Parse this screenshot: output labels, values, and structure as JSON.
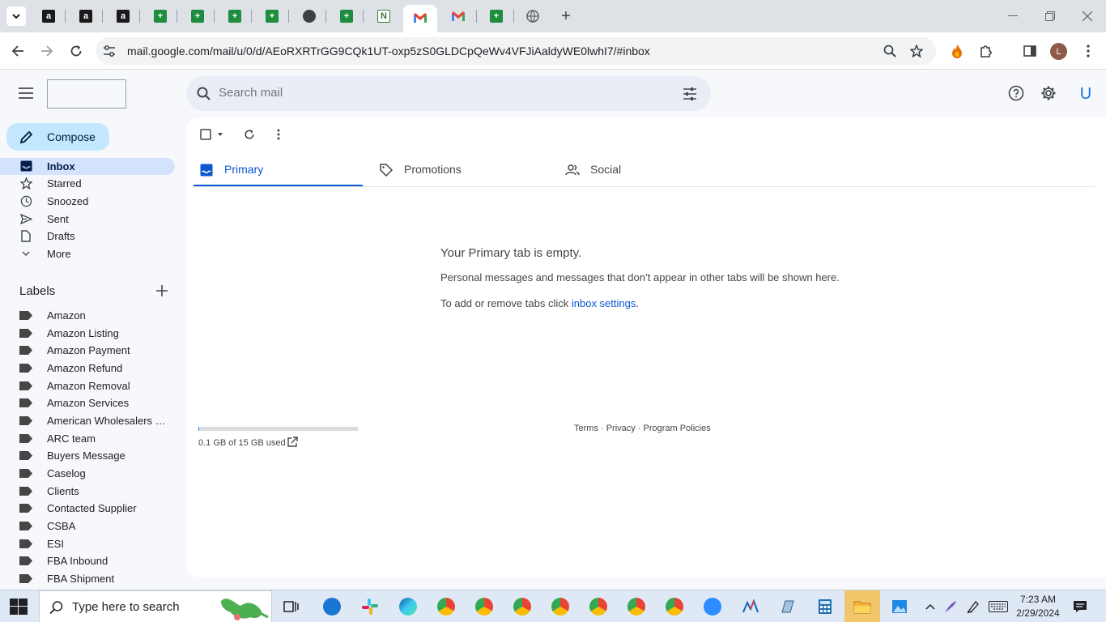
{
  "browser": {
    "url": "mail.google.com/mail/u/0/d/AEoRXRTrGG9CQk1UT-oxp5zS0GLDCpQeWv4VFJiAaldyWE0lwhI7/#inbox",
    "profile_initial": "L",
    "tabs": [
      {
        "icon": "amazon-icon",
        "glyph": "a"
      },
      {
        "icon": "amazon-icon",
        "glyph": "a"
      },
      {
        "icon": "amazon-icon",
        "glyph": "a"
      },
      {
        "icon": "sheets-icon",
        "glyph": "+"
      },
      {
        "icon": "sheets-icon",
        "glyph": "+"
      },
      {
        "icon": "sheets-icon",
        "glyph": "+"
      },
      {
        "icon": "sheets-icon",
        "glyph": "+"
      },
      {
        "icon": "globe-icon",
        "glyph": ""
      },
      {
        "icon": "sheets-icon",
        "glyph": "+"
      },
      {
        "icon": "green-logo-icon",
        "glyph": "N"
      },
      {
        "icon": "gmail-icon",
        "glyph": "M"
      },
      {
        "icon": "gmail-icon",
        "glyph": "M"
      },
      {
        "icon": "sheets-icon",
        "glyph": "+"
      },
      {
        "icon": "globe-icon",
        "glyph": ""
      }
    ]
  },
  "gmail": {
    "search_placeholder": "Search mail",
    "account_initial": "U",
    "compose_label": "Compose",
    "nav": [
      {
        "label": "Inbox",
        "icon": "inbox-icon",
        "active": true
      },
      {
        "label": "Starred",
        "icon": "star-icon"
      },
      {
        "label": "Snoozed",
        "icon": "clock-icon"
      },
      {
        "label": "Sent",
        "icon": "send-icon"
      },
      {
        "label": "Drafts",
        "icon": "draft-icon"
      },
      {
        "label": "More",
        "icon": "chevron-down-icon"
      }
    ],
    "labels_title": "Labels",
    "labels": [
      "Amazon",
      "Amazon Listing",
      "Amazon Payment",
      "Amazon Refund",
      "Amazon Removal",
      "Amazon Services",
      "American Wholesalers L...",
      "ARC team",
      "Buyers Message",
      "Caselog",
      "Clients",
      "Contacted Supplier",
      "CSBA",
      "ESI",
      "FBA Inbound",
      "FBA Shipment"
    ],
    "tabs": {
      "primary": "Primary",
      "promotions": "Promotions",
      "social": "Social"
    },
    "empty": {
      "title": "Your Primary tab is empty.",
      "description": "Personal messages and messages that don’t appear in other tabs will be shown here.",
      "settings_prefix": "To add or remove tabs click ",
      "settings_link": "inbox settings",
      "settings_suffix": "."
    },
    "storage": {
      "text": "0.1 GB of 15 GB used",
      "used_fraction": 0.007
    },
    "footer": "Terms · Privacy · Program Policies"
  },
  "taskbar": {
    "search_placeholder": "Type here to search",
    "time": "7:23 AM",
    "date": "2/29/2024"
  },
  "colors": {
    "accent": "#0b57d0",
    "compose_bg": "#c2e7ff",
    "nav_active_bg": "#d3e3fd"
  }
}
